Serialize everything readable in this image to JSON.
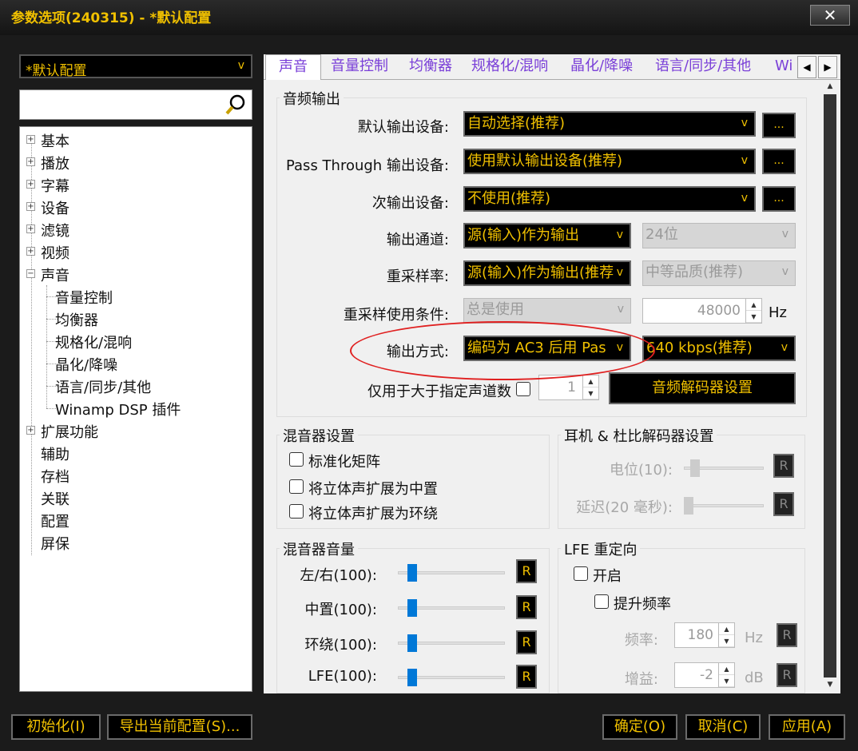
{
  "window": {
    "title": "参数选项(240315) - *默认配置",
    "close_symbol": "✕"
  },
  "sidebar": {
    "profile": "*默认配置",
    "tree": [
      {
        "label": "基本",
        "expander": "+"
      },
      {
        "label": "播放",
        "expander": "+"
      },
      {
        "label": "字幕",
        "expander": "+"
      },
      {
        "label": "设备",
        "expander": "+"
      },
      {
        "label": "滤镜",
        "expander": "+"
      },
      {
        "label": "视频",
        "expander": "+"
      },
      {
        "label": "声音",
        "expander": "−"
      },
      {
        "label": "音量控制"
      },
      {
        "label": "均衡器"
      },
      {
        "label": "规格化/混响"
      },
      {
        "label": "晶化/降噪"
      },
      {
        "label": "语言/同步/其他"
      },
      {
        "label": "Winamp DSP 插件"
      },
      {
        "label": "扩展功能",
        "expander": "+"
      },
      {
        "label": "辅助"
      },
      {
        "label": "存档"
      },
      {
        "label": "关联"
      },
      {
        "label": "配置"
      },
      {
        "label": "屏保"
      }
    ]
  },
  "tabs": [
    "声音",
    "音量控制",
    "均衡器",
    "规格化/混响",
    "晶化/降噪",
    "语言/同步/其他",
    "Wi"
  ],
  "tab_scroll": {
    "left": "◀",
    "right": "▶"
  },
  "audio_output": {
    "group_title": "音频输出",
    "default_device_label": "默认输出设备:",
    "default_device_value": "自动选择(推荐)",
    "pass_through_label": "Pass Through 输出设备:",
    "pass_through_value": "使用默认输出设备(推荐)",
    "secondary_label": "次输出设备:",
    "secondary_value": "不使用(推荐)",
    "channels_label": "输出通道:",
    "channels_value": "源(输入)作为输出",
    "bits_value": "24位",
    "resample_label": "重采样率:",
    "resample_value": "源(输入)作为输出(推荐",
    "quality_value": "中等品质(推荐)",
    "resample_cond_label": "重采样使用条件:",
    "resample_cond_value": "总是使用",
    "hz_value": "48000",
    "hz_unit": "Hz",
    "output_mode_label": "输出方式:",
    "output_mode_value": "编码为 AC3 后用 Pas",
    "bitrate_value": "640 kbps(推荐)",
    "channel_count_label": "仅用于大于指定声道数",
    "channel_count_value": "1",
    "decoder_button": "音频解码器设置",
    "more_button": "..."
  },
  "mixer": {
    "group_title": "混音器设置",
    "options": [
      "标准化矩阵",
      "将立体声扩展为中置",
      "将立体声扩展为环绕"
    ]
  },
  "headphone": {
    "group_title": "耳机 & 杜比解码器设置",
    "level_label": "电位(10):",
    "delay_label": "延迟(20 毫秒):",
    "r_label": "R"
  },
  "mixer_volume": {
    "group_title": "混音器音量",
    "rows": [
      {
        "label": "左/右(100):",
        "level": 100
      },
      {
        "label": "中置(100):",
        "level": 100
      },
      {
        "label": "环绕(100):",
        "level": 100
      },
      {
        "label": "LFE(100):",
        "level": 100
      }
    ]
  },
  "lfe": {
    "group_title": "LFE 重定向",
    "enable_label": "开启",
    "boost_label": "提升频率",
    "freq_label": "频率:",
    "freq_value": "180",
    "freq_unit": "Hz",
    "gain_label": "增益:",
    "gain_value": "-2",
    "gain_unit": "dB"
  },
  "footer": {
    "init_button": "初始化(I)",
    "export_button": "导出当前配置(S)...",
    "ok_button": "确定(O)",
    "cancel_button": "取消(C)",
    "apply_button": "应用(A)"
  },
  "colors": {
    "accent": "#f0c000",
    "tab_text": "#7a3fd8",
    "annotation": "#e02020"
  }
}
